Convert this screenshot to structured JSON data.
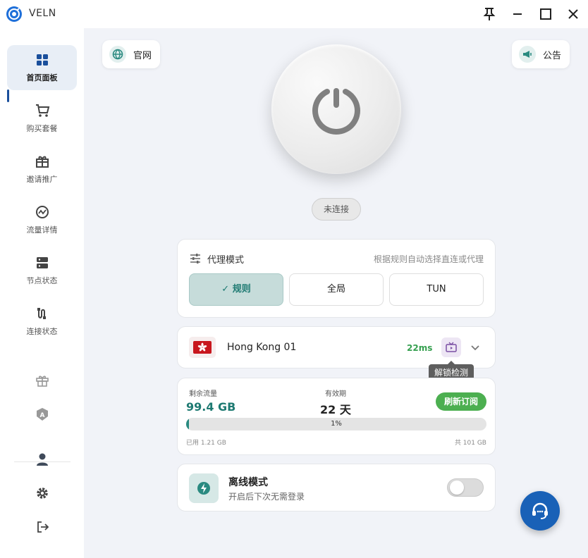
{
  "app": {
    "title": "VELN"
  },
  "sidebar": {
    "items": [
      {
        "label": "首页面板",
        "icon": "dashboard-icon",
        "active": true
      },
      {
        "label": "购买套餐",
        "icon": "cart-icon"
      },
      {
        "label": "邀请推广",
        "icon": "gift-box-icon"
      },
      {
        "label": "流量详情",
        "icon": "traffic-chart-icon"
      },
      {
        "label": "节点状态",
        "icon": "server-icon"
      },
      {
        "label": "连接状态",
        "icon": "plug-icon"
      }
    ],
    "bottom_icons": [
      "gift-icon",
      "badge-a-icon",
      "user-icon",
      "gear-icon",
      "logout-icon"
    ]
  },
  "header": {
    "website_label": "官网",
    "notice_label": "公告"
  },
  "connection": {
    "status": "未连接"
  },
  "proxy_mode": {
    "title": "代理模式",
    "hint": "根据规则自动选择直连或代理",
    "modes": [
      {
        "label": "✓ 规则",
        "active": true
      },
      {
        "label": "全局"
      },
      {
        "label": "TUN"
      }
    ]
  },
  "node": {
    "name": "Hong Kong 01",
    "latency": "22ms",
    "tooltip": "解锁检测"
  },
  "traffic": {
    "remaining_label": "剩余流量",
    "remaining_value": "99.4 GB",
    "validity_label": "有效期",
    "validity_value": "22 天",
    "refresh_label": "刷新订阅",
    "progress": 1,
    "progress_text": "1%",
    "used_text": "已用 1.21 GB",
    "total_text": "共 101 GB"
  },
  "offline": {
    "title": "离线模式",
    "description": "开启后下次无需登录",
    "enabled": false
  },
  "colors": {
    "accent": "#2a8a80",
    "brand": "#1961b7",
    "latency": "#36a050",
    "refresh": "#4caf50"
  }
}
